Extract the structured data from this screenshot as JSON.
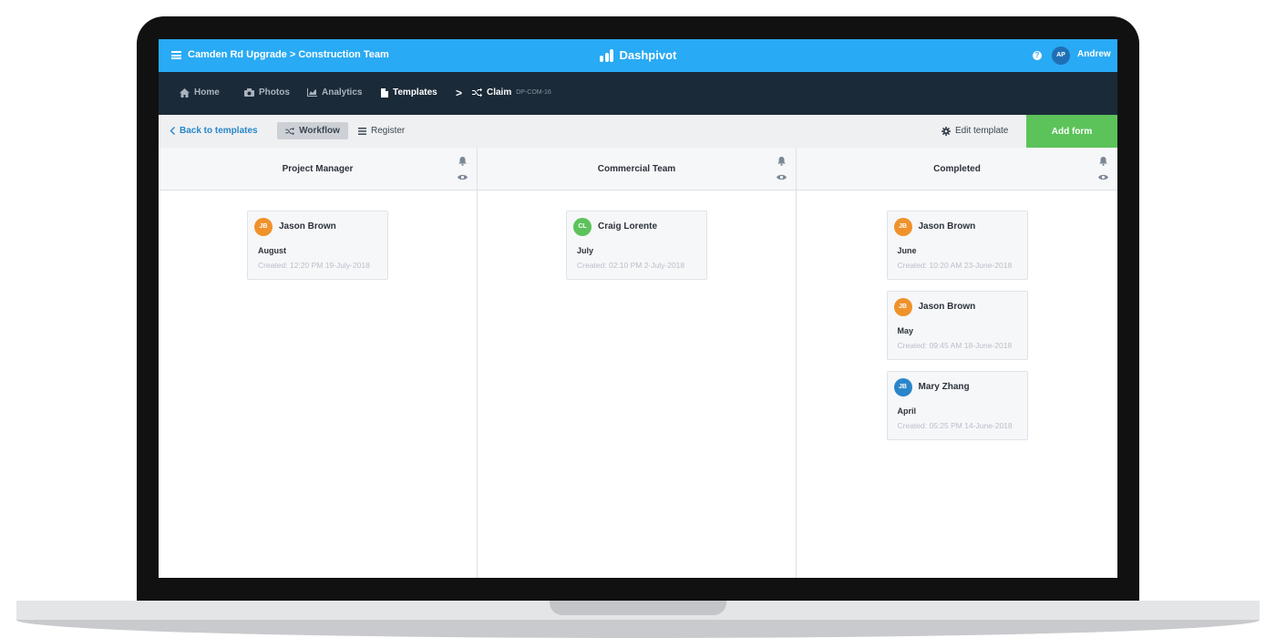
{
  "topbar": {
    "project_path": "Camden Rd Upgrade > Construction Team",
    "brand": "Dashpivot",
    "user_initials": "AP",
    "user_name": "Andrew",
    "help": "?"
  },
  "nav": {
    "items": [
      {
        "label": "Home",
        "icon": "home-icon"
      },
      {
        "label": "Photos",
        "icon": "camera-icon"
      },
      {
        "label": "Analytics",
        "icon": "chart-icon"
      },
      {
        "label": "Templates",
        "icon": "document-icon"
      }
    ],
    "separator": ">",
    "current": {
      "label": "Claim",
      "code": "DP-COM-16",
      "icon": "shuffle-icon"
    }
  },
  "toolbar": {
    "back_label": "Back to templates",
    "workflow_label": "Workflow",
    "register_label": "Register",
    "edit_template_label": "Edit template",
    "add_form_label": "Add form"
  },
  "colors": {
    "topbar": "#29aaf4",
    "navbar": "#1b2a38",
    "add_form": "#5cc25a",
    "avatar_orange": "#f0922b",
    "avatar_green": "#5cc25a",
    "avatar_blue": "#2a86c9"
  },
  "columns": [
    {
      "title": "Project Manager",
      "cards": [
        {
          "initials": "JB",
          "color": "#f0922b",
          "name": "Jason Brown",
          "period": "August",
          "created": "Created: 12:20 PM 19-July-2018"
        }
      ]
    },
    {
      "title": "Commercial Team",
      "cards": [
        {
          "initials": "CL",
          "color": "#5cc25a",
          "name": "Craig Lorente",
          "period": "July",
          "created": "Created: 02:10 PM 2-July-2018"
        }
      ]
    },
    {
      "title": "Completed",
      "cards": [
        {
          "initials": "JB",
          "color": "#f0922b",
          "name": "Jason Brown",
          "period": "June",
          "created": "Created: 10:20 AM 23-June-2018"
        },
        {
          "initials": "JB",
          "color": "#f0922b",
          "name": "Jason Brown",
          "period": "May",
          "created": "Created: 09:45 AM 18-June-2018"
        },
        {
          "initials": "JB",
          "color": "#2a86c9",
          "name": "Mary Zhang",
          "period": "April",
          "created": "Created: 05:25 PM 14-June-2018"
        }
      ]
    }
  ]
}
